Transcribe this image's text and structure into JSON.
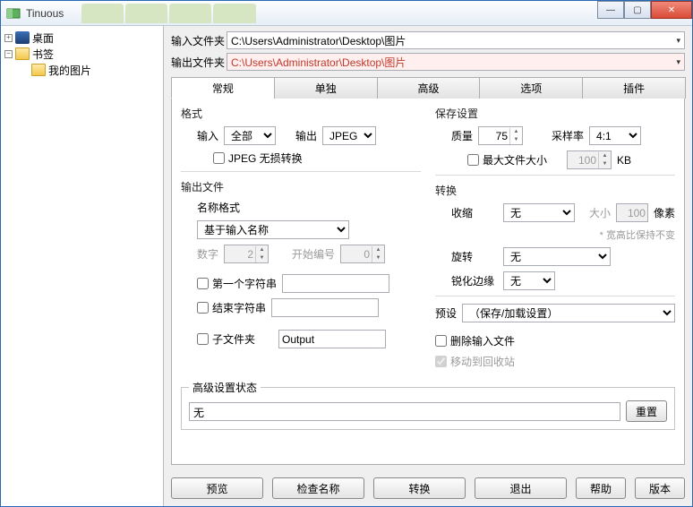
{
  "window": {
    "title": "Tinuous"
  },
  "bg_tabs": [
    "...",
    "...",
    "...",
    "..."
  ],
  "win_controls": {
    "min": "—",
    "max": "▢",
    "close": "✕"
  },
  "tree": {
    "desktop": "桌面",
    "bookmarks": "书签",
    "mypics": "我的图片",
    "plus": "+",
    "minus": "−"
  },
  "paths": {
    "in_label": "输入文件夹",
    "out_label": "输出文件夹",
    "in_value": "C:\\Users\\Administrator\\Desktop\\图片",
    "out_value": "C:\\Users\\Administrator\\Desktop\\图片",
    "arrow": "▾"
  },
  "tabs": {
    "t0": "常规",
    "t1": "单独",
    "t2": "高级",
    "t3": "选项",
    "t4": "插件"
  },
  "format": {
    "group": "格式",
    "in_label": "输入",
    "in_value": "全部",
    "out_label": "输出",
    "out_value": "JPEG",
    "lossless": "JPEG 无损转换"
  },
  "save": {
    "group": "保存设置",
    "quality_label": "质量",
    "quality_value": "75",
    "sample_label": "采样率",
    "sample_value": "4:1",
    "maxsize_label": "最大文件大小",
    "maxsize_value": "100",
    "kb": "KB"
  },
  "outfile": {
    "group": "输出文件",
    "name_format_label": "名称格式",
    "name_format_value": "基于输入名称",
    "digits_label": "数字",
    "digits_value": "2",
    "startnum_label": "开始编号",
    "startnum_value": "0",
    "first_str": "第一个字符串",
    "first_str_value": "",
    "end_str": "结束字符串",
    "end_str_value": "",
    "subfolder": "子文件夹",
    "subfolder_value": "Output"
  },
  "convert": {
    "group": "转换",
    "shrink_label": "收缩",
    "shrink_value": "无",
    "size_label": "大小",
    "size_value": "100",
    "px": "像素",
    "ratio_hint": "* 宽高比保持不变",
    "rotate_label": "旋转",
    "rotate_value": "无",
    "sharpen_label": "锐化边缘",
    "sharpen_value": "无"
  },
  "preset": {
    "label": "预设",
    "placeholder": "（保存/加载设置）",
    "delete_input": "删除输入文件",
    "recycle": "移动到回收站"
  },
  "adv": {
    "legend": "高级设置状态",
    "value": "无",
    "reset": "重置"
  },
  "buttons": {
    "preview": "预览",
    "check": "检查名称",
    "convert": "转换",
    "exit": "退出",
    "help": "帮助",
    "version": "版本"
  }
}
